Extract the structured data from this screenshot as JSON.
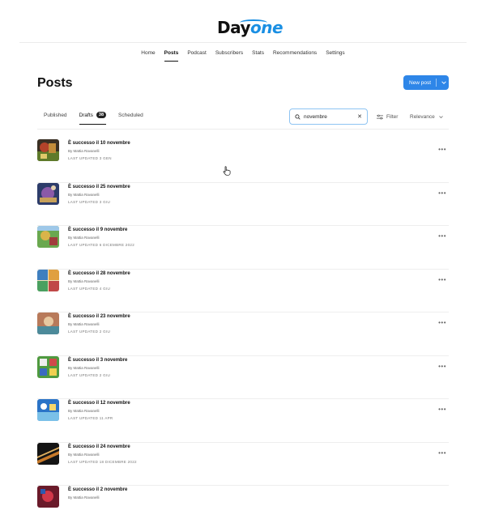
{
  "logo": {
    "part1": "Day",
    "part2": "one"
  },
  "nav": [
    "Home",
    "Posts",
    "Podcast",
    "Subscribers",
    "Stats",
    "Recommendations",
    "Settings"
  ],
  "nav_active": "Posts",
  "page_title": "Posts",
  "new_post_label": "New post",
  "tabs": {
    "published": "Published",
    "drafts": "Drafts",
    "drafts_count": "38",
    "scheduled": "Scheduled"
  },
  "search": {
    "value": "novembre",
    "placeholder": "Search"
  },
  "filter_label": "Filter",
  "sort_label": "Relevance",
  "posts": [
    {
      "title": "È successo il 10 novembre",
      "author": "By Mattia Ravanelli",
      "updated": "LAST UPDATED 3 GEN"
    },
    {
      "title": "È successo il 25 novembre",
      "author": "By Mattia Ravanelli",
      "updated": "LAST UPDATED 3 GIU"
    },
    {
      "title": "È successo il 9 novembre",
      "author": "By Mattia Ravanelli",
      "updated": "LAST UPDATED 6 DICEMBRE 2022"
    },
    {
      "title": "È successo il 28 novembre",
      "author": "By Mattia Ravanelli",
      "updated": "LAST UPDATED 4 GIU"
    },
    {
      "title": "È successo il 23 novembre",
      "author": "By Mattia Ravanelli",
      "updated": "LAST UPDATED 2 GIU"
    },
    {
      "title": "È successo il 3 novembre",
      "author": "By Mattia Ravanelli",
      "updated": "LAST UPDATED 2 GIU"
    },
    {
      "title": "È successo il 12 novembre",
      "author": "By Mattia Ravanelli",
      "updated": "LAST UPDATED 11 APR"
    },
    {
      "title": "È successo il 24 novembre",
      "author": "By Mattia Ravanelli",
      "updated": "LAST UPDATED 18 DICEMBRE 2022"
    },
    {
      "title": "È successo il 2 novembre",
      "author": "By Mattia Ravanelli",
      "updated": ""
    }
  ],
  "more_glyph": "•••",
  "colors": {
    "accent": "#2e86e8",
    "logo_blue": "#1a8fe3"
  }
}
